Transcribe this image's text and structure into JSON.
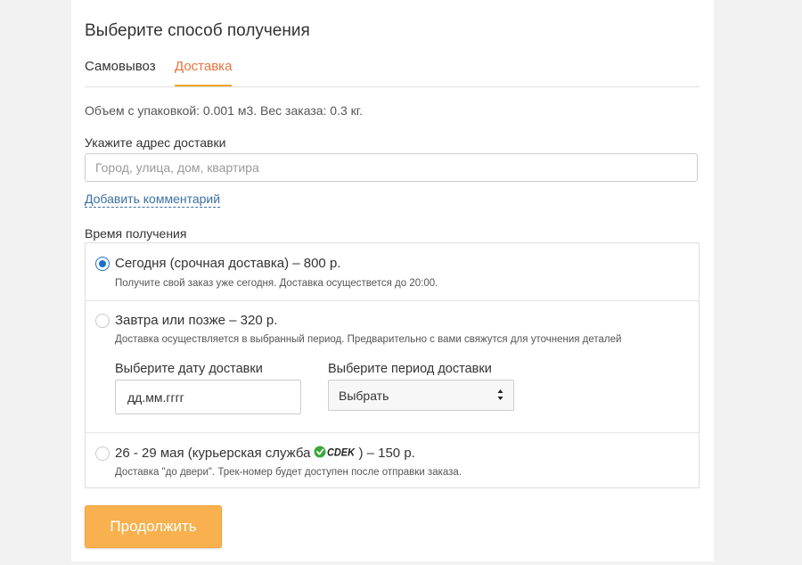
{
  "title": "Выберите способ получения",
  "tabs": [
    {
      "label": "Самовывоз",
      "active": false
    },
    {
      "label": "Доставка",
      "active": true
    }
  ],
  "volume_info": "Объем с упаковкой: 0.001 м3. Вес заказа: 0.3 кг.",
  "address": {
    "label": "Укажите адрес доставки",
    "placeholder": "Город, улица, дом, квартира",
    "value": ""
  },
  "comment_link": "Добавить комментарий",
  "time_section": {
    "label": "Время получения",
    "options": [
      {
        "title": "Сегодня (срочная доставка) – 800 р.",
        "subtitle": "Получите свой заказ уже сегодня. Доставка осуществется до 20:00.",
        "selected": true
      },
      {
        "title": "Завтра или позже – 320 р.",
        "subtitle": "Доставка осуществляется в выбранный период. Предварительно с вами свяжутся для уточнения деталей",
        "selected": false,
        "date_label": "Выберите дату доставки",
        "date_placeholder": "дд.мм.гггг",
        "period_label": "Выберите период доставки",
        "period_value": "Выбрать"
      },
      {
        "title_prefix": "26 - 29 мая (курьерская служба",
        "carrier_logo": "СДЭК",
        "title_suffix": ") – 150 р.",
        "subtitle": "Доставка \"до двери\". Трек-номер будет доступен после отправки заказа.",
        "selected": false
      }
    ]
  },
  "continue_button": "Продолжить",
  "colors": {
    "accent_tab": "#e8743b",
    "tab_underline": "#f0a528",
    "radio_selected": "#1a72c8",
    "button_bg": "#f8b14e",
    "link": "#3a6fa0",
    "cdek_green": "#3aa83a"
  }
}
